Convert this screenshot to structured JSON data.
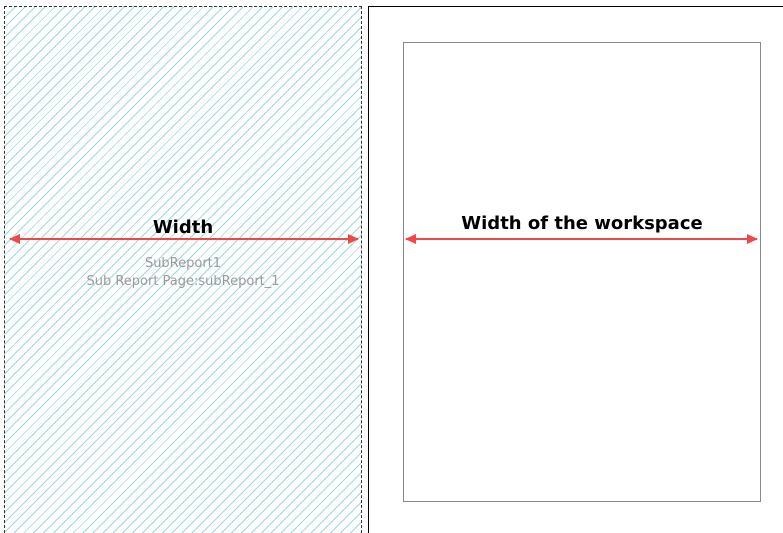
{
  "subreport_panel": {
    "width_label": "Width",
    "name": "SubReport1",
    "page_text": "Sub Report Page:subReport_1"
  },
  "workspace": {
    "width_label": "Width of the workspace"
  },
  "colors": {
    "arrow": "#f04848",
    "hatch": "#9fd7dc",
    "subreport_text": "#9a9a9a"
  }
}
